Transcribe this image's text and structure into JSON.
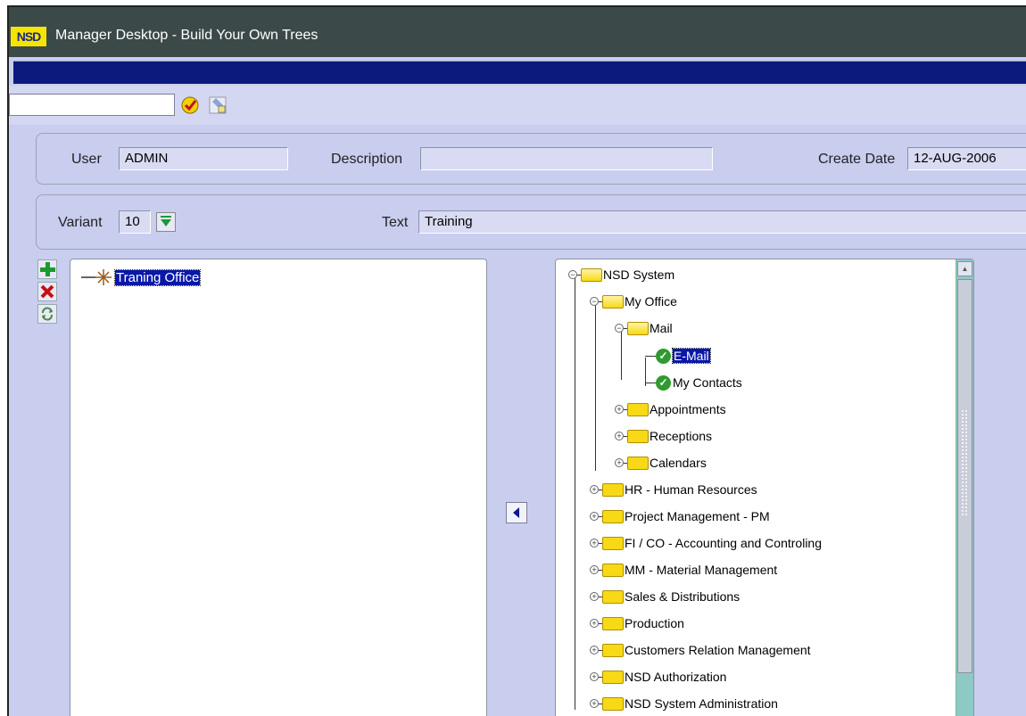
{
  "window": {
    "logo": "NSD",
    "title": "Manager Desktop - Build Your Own Trees"
  },
  "toolbar": {
    "input_value": ""
  },
  "form": {
    "user_label": "User",
    "user_value": "ADMIN",
    "description_label": "Description",
    "description_value": "",
    "create_date_label": "Create Date",
    "create_date_value": "12-AUG-2006",
    "variant_label": "Variant",
    "variant_value": "10",
    "text_label": "Text",
    "text_value": "Training"
  },
  "left_tree": {
    "root": "Traning Office"
  },
  "right_tree": {
    "root": "NSD  System",
    "my_office": "My Office",
    "mail": "Mail",
    "email": "E-Mail",
    "my_contacts": "My Contacts",
    "appointments": "Appointments",
    "receptions": "Receptions",
    "calendars": "Calendars",
    "modules": [
      "HR - Human Resources",
      "Project Management - PM",
      "FI / CO - Accounting and Controling",
      "MM - Material Management",
      "Sales & Distributions",
      "Production",
      "Customers Relation Management",
      "NSD Authorization",
      "NSD System Administration"
    ]
  }
}
